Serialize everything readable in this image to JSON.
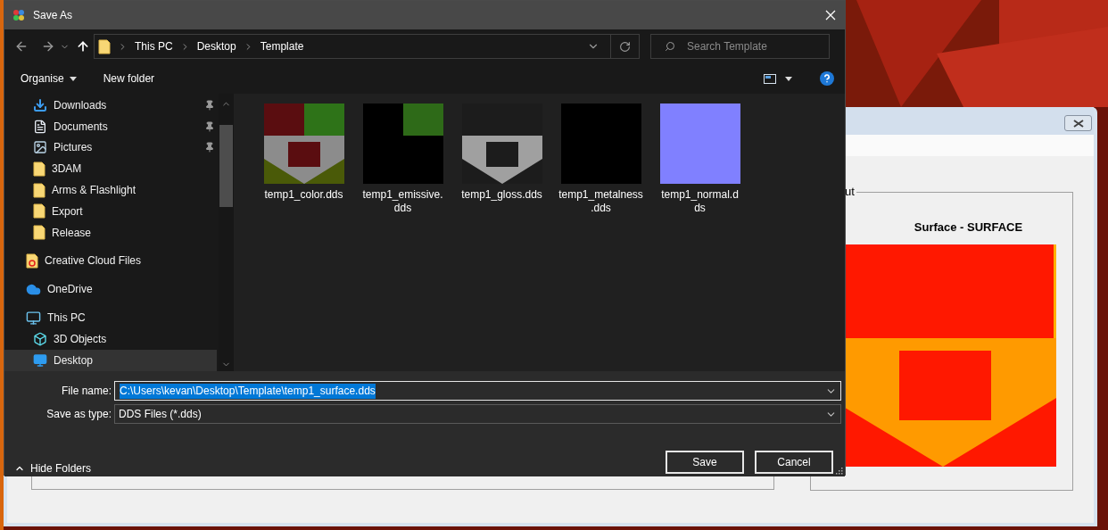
{
  "dialog": {
    "title": "Save As",
    "address": {
      "crumbs": [
        "This PC",
        "Desktop",
        "Template"
      ]
    },
    "search": {
      "placeholder": "Search Template"
    },
    "toolbar": {
      "organise": "Organise",
      "new_folder": "New folder"
    },
    "sidebar": {
      "quick_access": [
        {
          "label": "Downloads",
          "kind": "download",
          "pinned": true
        },
        {
          "label": "Documents",
          "kind": "document",
          "pinned": true
        },
        {
          "label": "Pictures",
          "kind": "pictures",
          "pinned": true
        },
        {
          "label": "3DAM",
          "kind": "folder",
          "pinned": false
        },
        {
          "label": "Arms & Flashlight",
          "kind": "folder",
          "pinned": false
        },
        {
          "label": "Export",
          "kind": "folder",
          "pinned": false
        },
        {
          "label": "Release",
          "kind": "folder",
          "pinned": false
        }
      ],
      "items": [
        {
          "label": "Creative Cloud Files",
          "kind": "cc-folder",
          "selected": false
        },
        {
          "label": "OneDrive",
          "kind": "cloud",
          "selected": false
        },
        {
          "label": "This PC",
          "kind": "computer",
          "selected": false,
          "children": [
            {
              "label": "3D Objects",
              "kind": "cube",
              "selected": false
            },
            {
              "label": "Desktop",
              "kind": "desktop",
              "selected": true
            }
          ]
        }
      ]
    },
    "files": [
      {
        "label_lines": [
          "temp1_color.dds"
        ],
        "kind": "color"
      },
      {
        "label_lines": [
          "temp1_emissive.",
          "dds"
        ],
        "kind": "emissive"
      },
      {
        "label_lines": [
          "temp1_gloss.dds"
        ],
        "kind": "gloss"
      },
      {
        "label_lines": [
          "temp1_metalness",
          ".dds"
        ],
        "kind": "metalness"
      },
      {
        "label_lines": [
          "temp1_normal.d",
          "ds"
        ],
        "kind": "normal"
      }
    ],
    "file_name": {
      "label": "File name:",
      "value": "C:\\Users\\kevan\\Desktop\\Template\\temp1_surface.dds"
    },
    "save_type": {
      "label": "Save as type:",
      "value": "DDS Files (*.dds)"
    },
    "hide_folders": "Hide Folders",
    "buttons": [
      "Save",
      "Cancel"
    ]
  },
  "background_window": {
    "group_label": "ut",
    "preview_title": "Surface - SURFACE"
  }
}
